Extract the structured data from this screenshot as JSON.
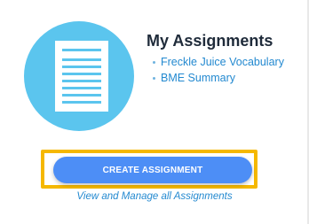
{
  "card": {
    "title": "My Assignments",
    "assignments": [
      {
        "label": "Freckle Juice Vocabulary"
      },
      {
        "label": "BME Summary"
      }
    ],
    "create_button_label": "CREATE ASSIGNMENT",
    "manage_link_label": "View and Manage all Assignments"
  },
  "icons": {
    "illustration": "document-icon",
    "bullet": "bullet-icon"
  },
  "colors": {
    "circle": "#5bc5ee",
    "title": "#1f2b3a",
    "link": "#2389d0",
    "button": "#4d8ef6",
    "highlight": "#f5b800"
  }
}
